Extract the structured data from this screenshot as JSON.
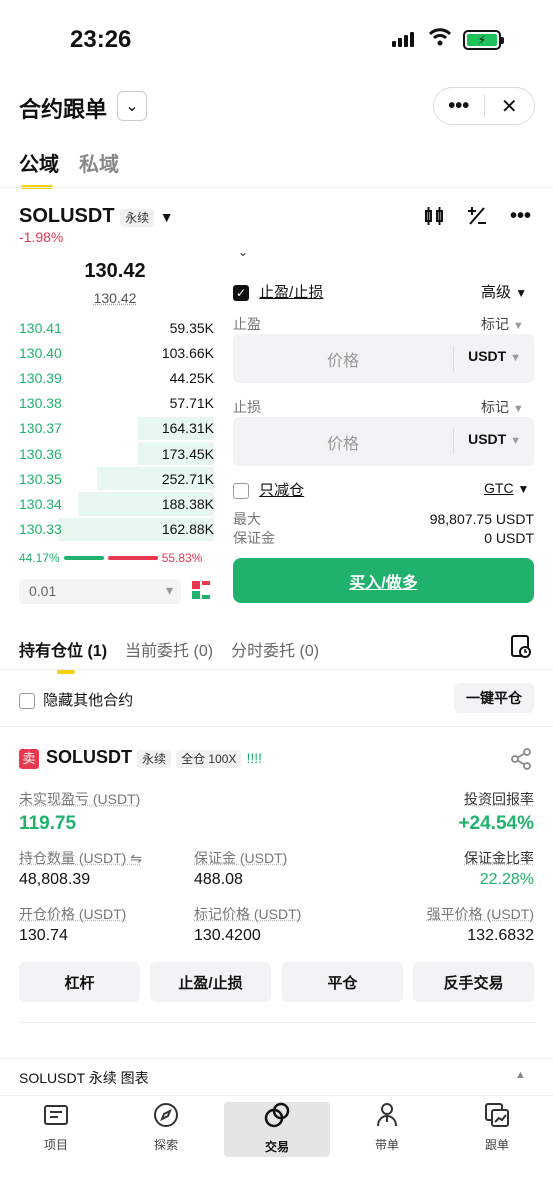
{
  "status": {
    "time": "23:26"
  },
  "header": {
    "title": "合约跟单",
    "more": "•••",
    "close": "✕"
  },
  "tabs": [
    "公域",
    "私域"
  ],
  "symbol": {
    "name": "SOLUSDT",
    "type": "永续",
    "change": "-1.98%"
  },
  "orderbook": {
    "last": "130.42",
    "mark": "130.42",
    "rows": [
      [
        "130.41",
        "59.35K",
        0
      ],
      [
        "130.40",
        "103.66K",
        0
      ],
      [
        "130.39",
        "44.25K",
        0
      ],
      [
        "130.38",
        "57.71K",
        0
      ],
      [
        "130.37",
        "164.31K",
        0.39
      ],
      [
        "130.36",
        "173.45K",
        0.39
      ],
      [
        "130.35",
        "252.71K",
        0.6
      ],
      [
        "130.34",
        "188.38K",
        0.7
      ],
      [
        "130.33",
        "162.88K",
        0.8
      ]
    ],
    "buy_pct": "44.17%",
    "sell_pct": "55.83%",
    "step": "0.01"
  },
  "form": {
    "tpsl_label": "止盈/止损",
    "advanced": "高级",
    "tp": "止盈",
    "sl": "止损",
    "mark": "标记",
    "price_placeholder": "价格",
    "currency": "USDT",
    "reduce_only": "只减仓",
    "gtc": "GTC",
    "max": "最大",
    "margin": "保证金",
    "max_val": "98,807.75 USDT",
    "margin_val": "0 USDT",
    "buy_btn": "买入/做多"
  },
  "ptabs": [
    {
      "label": "持有仓位",
      "count": "(1)"
    },
    {
      "label": "当前委托",
      "count": "(0)"
    },
    {
      "label": "分时委托",
      "count": "(0)"
    }
  ],
  "hide_other": "隐藏其他合约",
  "close_all": "一键平仓",
  "position": {
    "side": "卖",
    "symbol": "SOLUSDT",
    "type": "永续",
    "margin_mode": "全仓 100X",
    "bars": "!!!!",
    "pnl_label": "未实现盈亏 (USDT)",
    "pnl": "119.75",
    "roi_label": "投资回报率",
    "roi": "+24.54%",
    "qty_label": "持仓数量 (USDT) ⇋",
    "qty": "48,808.39",
    "margin_label": "保证金 (USDT)",
    "margin": "488.08",
    "mr_label": "保证金比率",
    "mr": "22.28%",
    "entry_label": "开仓价格 (USDT)",
    "entry": "130.74",
    "markp_label": "标记价格 (USDT)",
    "markp": "130.4200",
    "liq_label": "强平价格 (USDT)",
    "liq": "132.6832",
    "buttons": [
      "杠杆",
      "止盈/止损",
      "平仓",
      "反手交易"
    ]
  },
  "chart_bar": "SOLUSDT 永续  图表",
  "nav": [
    "项目",
    "探索",
    "交易",
    "带单",
    "跟单"
  ]
}
